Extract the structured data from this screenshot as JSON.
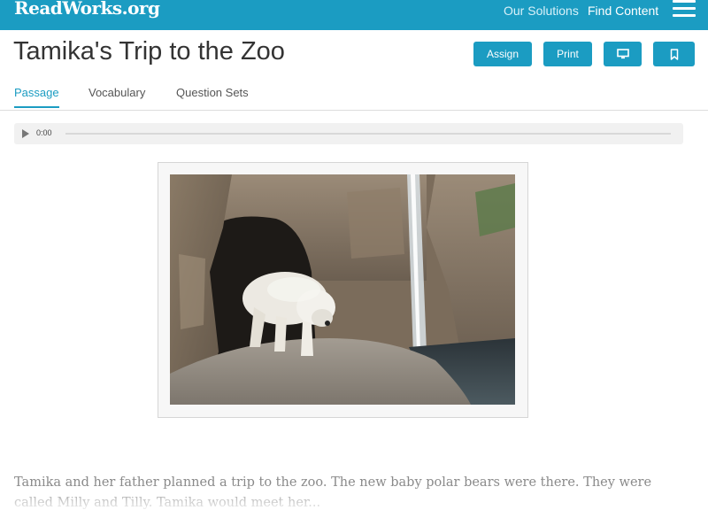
{
  "header": {
    "logo": "ReadWorks.org",
    "nav": [
      "Our Solutions",
      "Find Content"
    ],
    "menu_icon": "hamburger-menu-icon"
  },
  "article": {
    "title": "Tamika's Trip to the Zoo",
    "actions": {
      "assign": "Assign",
      "print": "Print",
      "present_icon": "monitor-icon",
      "bookmark_icon": "bookmark-icon"
    },
    "tabs": [
      {
        "label": "Passage",
        "active": true
      },
      {
        "label": "Vocabulary",
        "active": false
      },
      {
        "label": "Question Sets",
        "active": false
      }
    ]
  },
  "audio": {
    "time": "0:00",
    "progress": 0
  },
  "image": {
    "subject": "polar bear at zoo enclosure"
  },
  "passage": {
    "text": "Tamika and her father planned a trip to the zoo. The new baby polar bears were there. They were called Milly and Tilly. Tamika would meet her..."
  },
  "colors": {
    "brand": "#1b9cc2",
    "text": "#333333"
  }
}
